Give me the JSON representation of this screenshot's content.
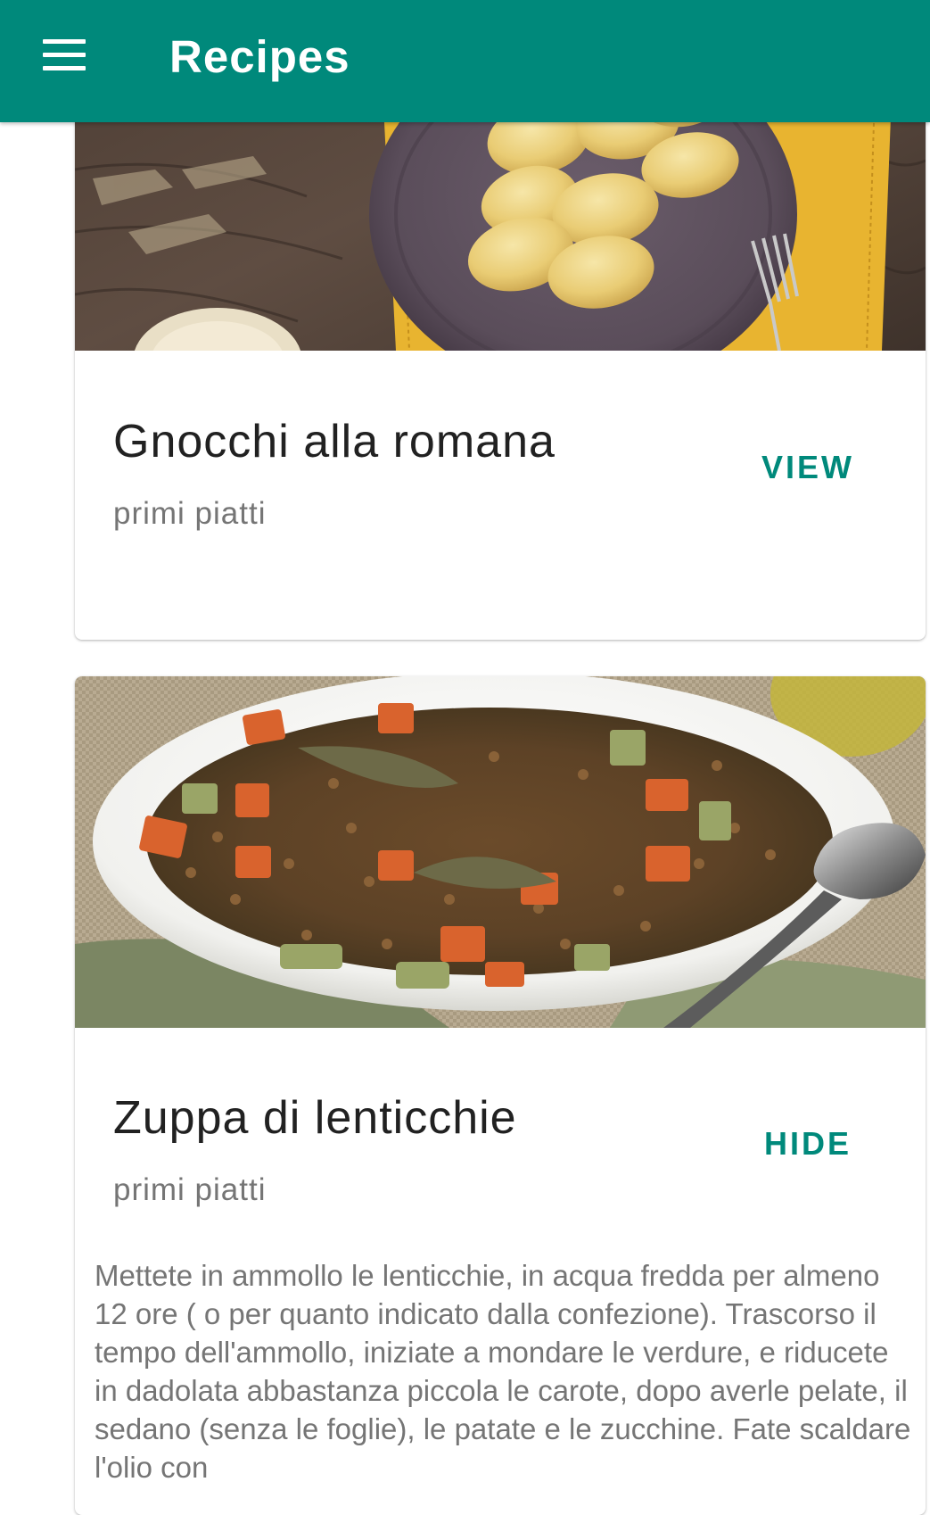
{
  "app_bar": {
    "title": "Recipes",
    "menu_icon": "hamburger-menu-icon",
    "color": "#00897b"
  },
  "recipes": [
    {
      "title": "Gnocchi alla romana",
      "category": "primi piatti",
      "action_label": "VIEW",
      "image": "gnocchi-alla-romana-photo"
    },
    {
      "title": "Zuppa di lenticchie",
      "category": "primi piatti",
      "action_label": "HIDE",
      "image": "zuppa-di-lenticchie-photo",
      "description": "Mettete in ammollo le lenticchie, in acqua fredda per almeno 12 ore ( o per quanto indicato dalla confezione). Trascorso il tempo dell'ammollo, iniziate a mondare le verdure, e riducete in dadolata abbastanza piccola le carote, dopo averle pelate, il sedano (senza le foglie), le patate e le zucchine. Fate scaldare l'olio con"
    }
  ]
}
